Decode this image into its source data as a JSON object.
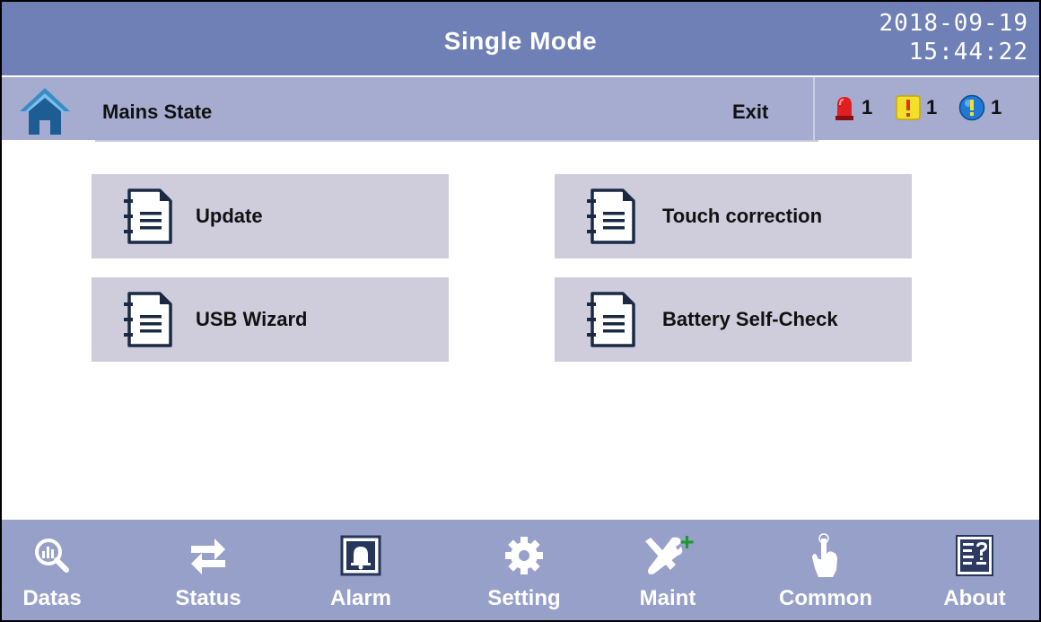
{
  "header": {
    "title": "Single Mode",
    "date": "2018-09-19",
    "time": "15:44:22"
  },
  "subheader": {
    "page_title": "Mains State",
    "exit_label": "Exit",
    "alarms": [
      {
        "icon": "red-siren-icon",
        "count": "1"
      },
      {
        "icon": "yellow-warning-icon",
        "count": "1"
      },
      {
        "icon": "blue-info-icon",
        "count": "1"
      }
    ]
  },
  "menu": {
    "items": [
      {
        "label": "Update",
        "icon": "document-icon"
      },
      {
        "label": "Touch correction",
        "icon": "document-icon"
      },
      {
        "label": "USB Wizard",
        "icon": "document-icon"
      },
      {
        "label": "Battery Self-Check",
        "icon": "document-icon"
      }
    ]
  },
  "nav": {
    "items": [
      {
        "label": "Datas",
        "icon": "magnifier-chart-icon"
      },
      {
        "label": "Status",
        "icon": "swap-arrows-icon"
      },
      {
        "label": "Alarm",
        "icon": "bell-icon"
      },
      {
        "label": "Setting",
        "icon": "gear-icon"
      },
      {
        "label": "Maint",
        "icon": "tools-icon"
      },
      {
        "label": "Common",
        "icon": "pointer-hand-icon"
      },
      {
        "label": "About",
        "icon": "help-document-icon"
      }
    ]
  },
  "colors": {
    "titlebar": "#6f80b6",
    "subbar": "#a5acd0",
    "button_bg": "#cfcddb",
    "navbar": "#97a0c9"
  }
}
